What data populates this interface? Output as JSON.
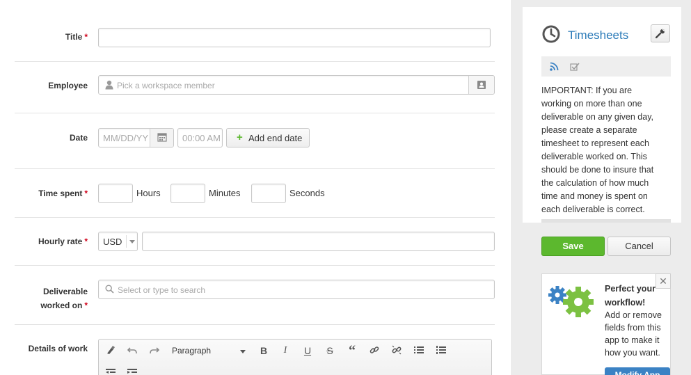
{
  "form": {
    "title": {
      "label": "Title",
      "required_mark": "*"
    },
    "employee": {
      "label": "Employee",
      "placeholder": "Pick a workspace member"
    },
    "date": {
      "label": "Date",
      "date_placeholder": "MM/DD/YY",
      "time_placeholder": "00:00 AM",
      "add_end_date": "Add end date"
    },
    "time_spent": {
      "label": "Time spent",
      "required_mark": "*",
      "hours": "Hours",
      "minutes": "Minutes",
      "seconds": "Seconds"
    },
    "hourly_rate": {
      "label": "Hourly rate",
      "required_mark": "*",
      "currency": "USD"
    },
    "deliverable": {
      "label_line1": "Deliverable",
      "label_line2": "worked on",
      "required_mark": "*",
      "placeholder": "Select or type to search"
    },
    "details": {
      "label": "Details of work",
      "format_select": "Paragraph"
    }
  },
  "sidebar": {
    "app_title": "Timesheets",
    "important_text": "IMPORTANT: If you are working on more than one deliverable on any given day, please create a separate timesheet to represent each deliverable worked on. This should be done to insure that the calculation of how much time and money is spent on each deliverable is correct.",
    "save_label": "Save",
    "cancel_label": "Cancel",
    "promo": {
      "title_line1": "Perfect your",
      "title_line2": "workflow!",
      "body": "Add or remove fields from this app to make it how you want.",
      "button": "Modify App"
    }
  },
  "colors": {
    "accent_blue": "#2a7ab8",
    "save_green": "#5cb82e",
    "required_red": "#d0021b",
    "promo_gear_green": "#7cc142",
    "promo_gear_blue": "#3b82c4"
  }
}
